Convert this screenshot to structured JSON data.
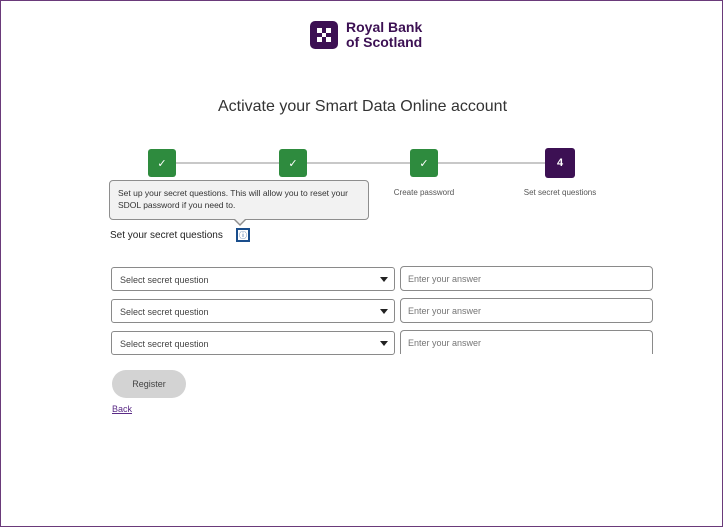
{
  "brand": {
    "line1": "Royal Bank",
    "line2": "of Scotland"
  },
  "page": {
    "title": "Activate your Smart Data Online account"
  },
  "stepper": {
    "steps": [
      {
        "state": "done",
        "icon": "✓",
        "label": ""
      },
      {
        "state": "done",
        "icon": "✓",
        "label": ""
      },
      {
        "state": "done",
        "icon": "✓",
        "label": "Create password"
      },
      {
        "state": "current",
        "icon": "4",
        "label": "Set secret questions"
      }
    ]
  },
  "tooltip": {
    "text": "Set up your secret questions. This will allow you to reset your SDOL password if you need to."
  },
  "form": {
    "section_label": "Set your secret questions",
    "info_icon": "ⓘ",
    "rows": [
      {
        "question_placeholder": "Select secret question",
        "answer_placeholder": "Enter your answer"
      },
      {
        "question_placeholder": "Select secret question",
        "answer_placeholder": "Enter your answer"
      },
      {
        "question_placeholder": "Select secret question",
        "answer_placeholder": "Enter your answer"
      }
    ],
    "register_label": "Register",
    "back_label": "Back"
  },
  "colors": {
    "brand": "#3c1053",
    "step_done": "#2e8b3e",
    "link": "#5a2a86"
  }
}
